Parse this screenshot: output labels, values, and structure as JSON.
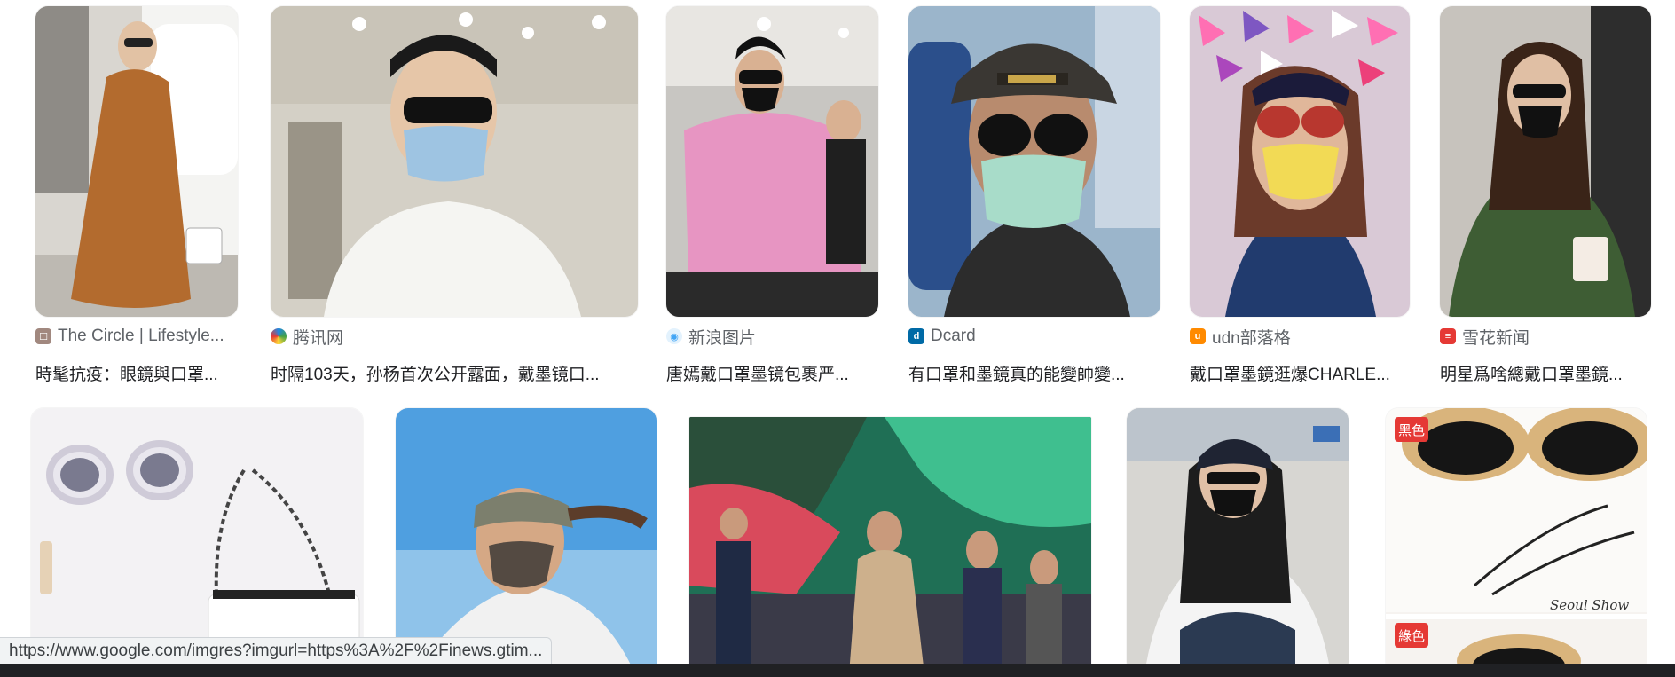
{
  "row1": [
    {
      "source": "The Circle | Lifestyle...",
      "title": "時髦抗疫：眼鏡與口罩...",
      "favicon": "circle-favicon-icon",
      "favicon_color": "#a1887f"
    },
    {
      "source": "腾讯网",
      "title": "时隔103天，孙杨首次公开露面，戴墨镜口...",
      "favicon": "tencent-favicon-icon",
      "favicon_color": "#1e88e5"
    },
    {
      "source": "新浪图片",
      "title": "唐嫣戴口罩墨镜包裹严...",
      "favicon": "sina-favicon-icon",
      "favicon_color": "#42a5f5"
    },
    {
      "source": "Dcard",
      "title": "有口罩和墨鏡真的能變帥變...",
      "favicon": "dcard-favicon-icon",
      "favicon_color": "#006aa6"
    },
    {
      "source": "udn部落格",
      "title": "戴口罩墨鏡逛爆CHARLE...",
      "favicon": "udn-favicon-icon",
      "favicon_color": "#ff8a00"
    },
    {
      "source": "雪花新闻",
      "title": "明星爲啥總戴口罩墨鏡...",
      "favicon": "xuehua-favicon-icon",
      "favicon_color": "#e53935"
    }
  ],
  "row2_badges": {
    "black": "黑色",
    "green": "綠色"
  },
  "row2_watermark": "Seoul Show",
  "status_url": "https://www.google.com/imgres?imgurl=https%3A%2F%2Finews.gtim..."
}
